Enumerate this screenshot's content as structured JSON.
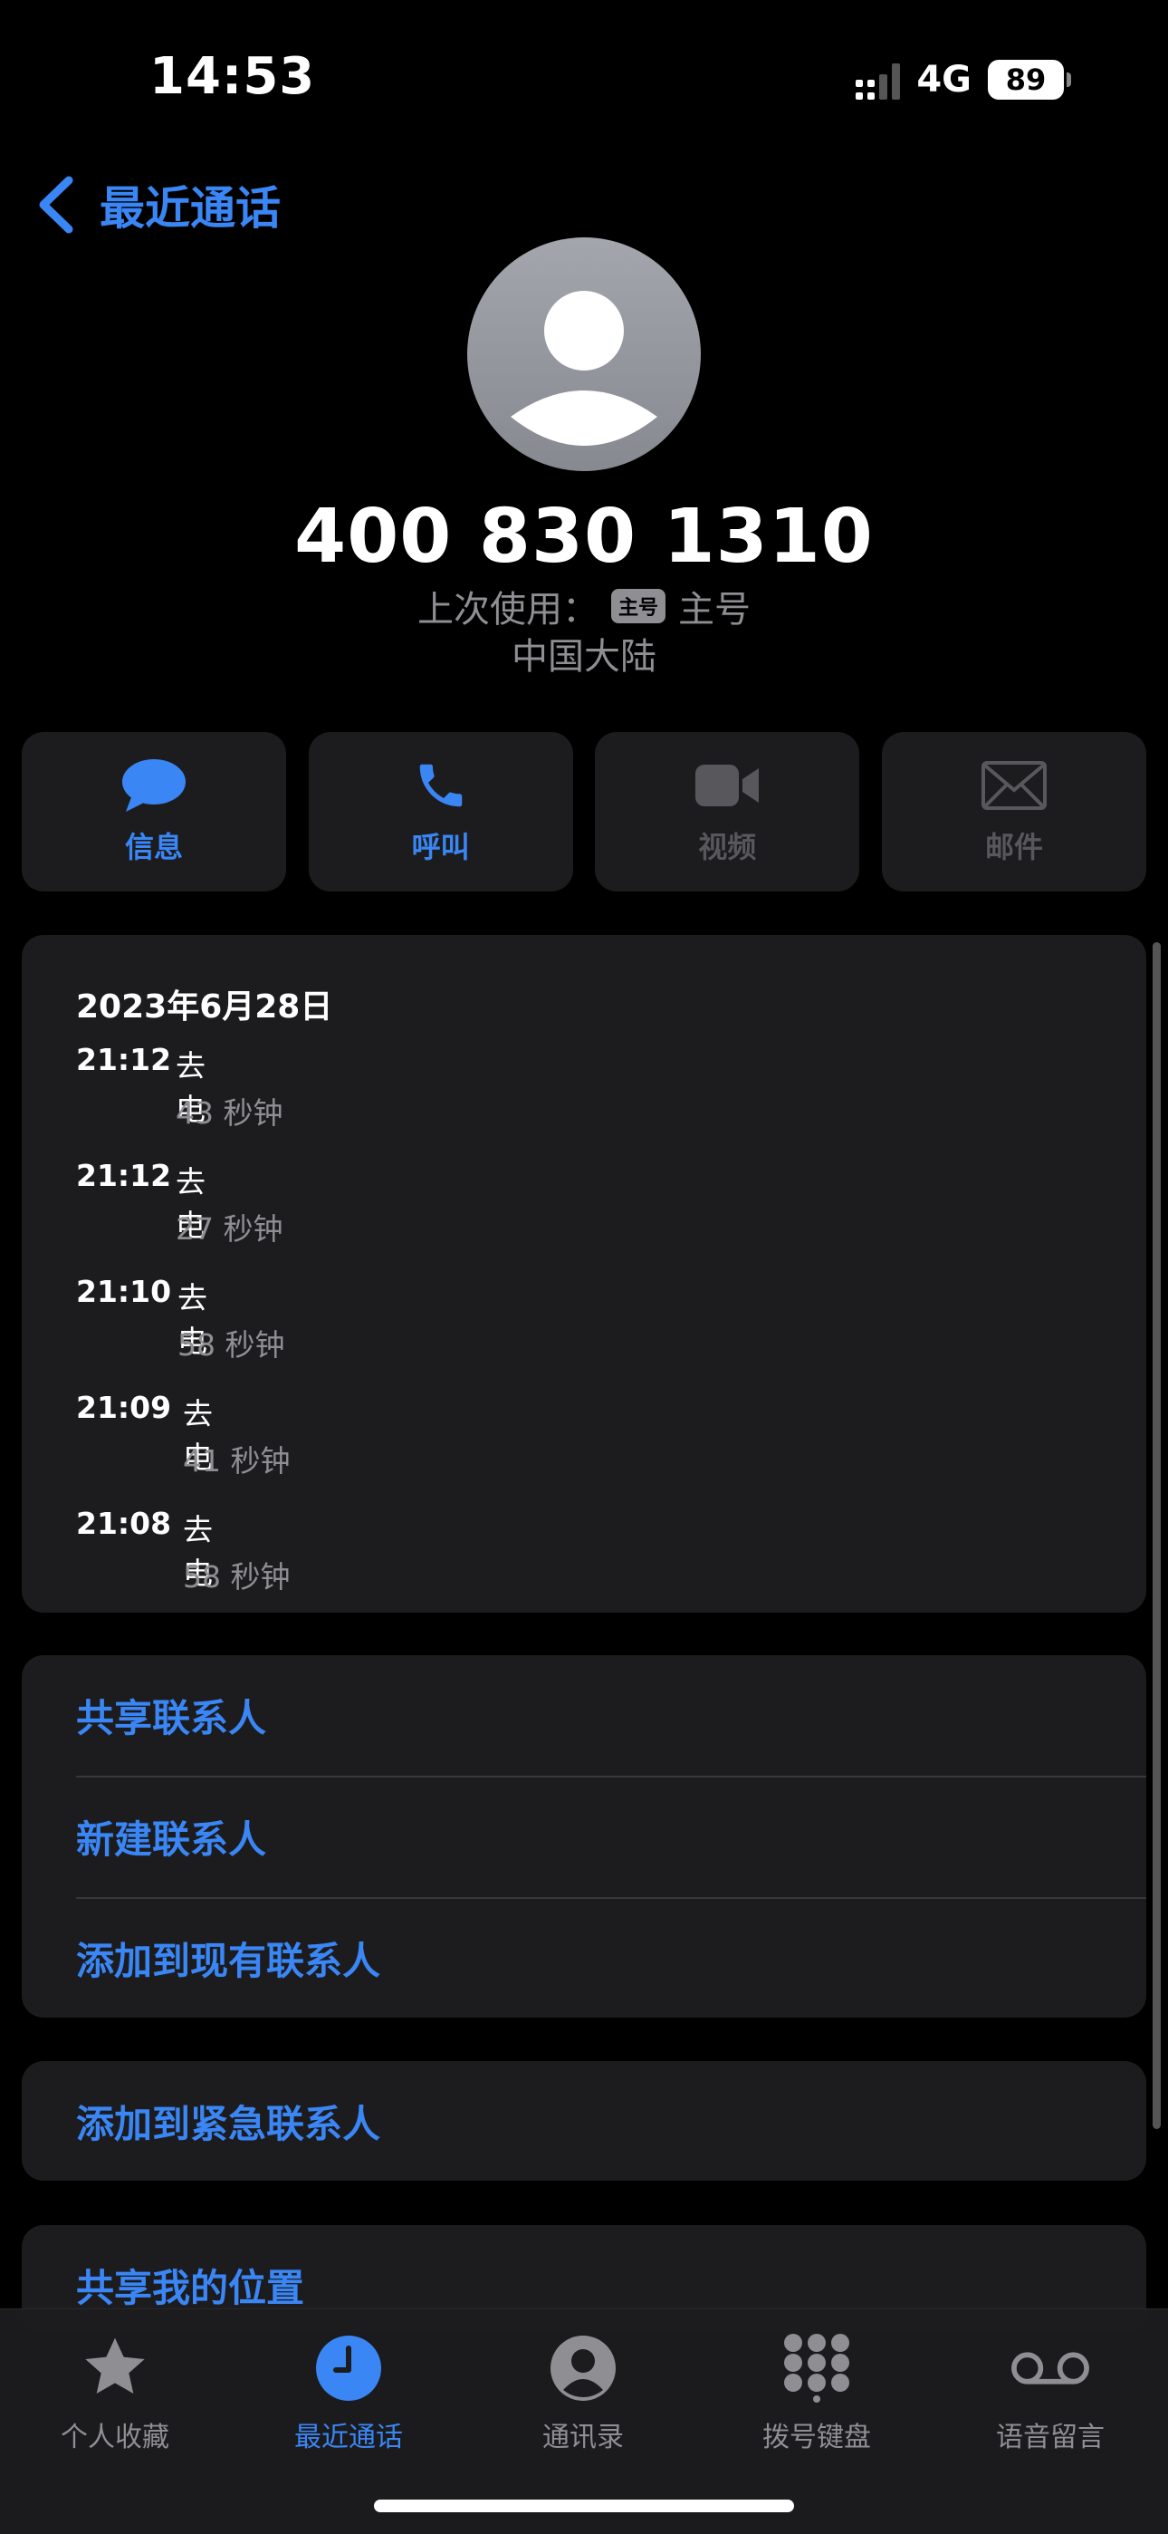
{
  "status_bar": {
    "time": "14:53",
    "network": "4G",
    "battery": "89"
  },
  "nav": {
    "back_label": "最近通话"
  },
  "contact": {
    "number": "400 830 1310",
    "last_used_label": "上次使用：",
    "line_tag": "主号",
    "line_name": "主号",
    "region": "中国大陆"
  },
  "actions": [
    {
      "label": "信息",
      "icon": "message-icon",
      "enabled": true
    },
    {
      "label": "呼叫",
      "icon": "phone-icon",
      "enabled": true
    },
    {
      "label": "视频",
      "icon": "video-icon",
      "enabled": false
    },
    {
      "label": "邮件",
      "icon": "mail-icon",
      "enabled": false
    }
  ],
  "history": {
    "date": "2023年6月28日",
    "calls": [
      {
        "time": "21:12",
        "type": "去电",
        "duration": "43 秒钟"
      },
      {
        "time": "21:12",
        "type": "去电",
        "duration": "27 秒钟"
      },
      {
        "time": "21:10",
        "type": "去电",
        "duration": "58 秒钟"
      },
      {
        "time": "21:09",
        "type": "去电",
        "duration": "41 秒钟"
      },
      {
        "time": "21:08",
        "type": "去电",
        "duration": "58 秒钟"
      }
    ]
  },
  "contact_actions": {
    "share": "共享联系人",
    "new": "新建联系人",
    "add_existing": "添加到现有联系人"
  },
  "emergency": "添加到紧急联系人",
  "share_location": "共享我的位置",
  "tabs": [
    {
      "label": "个人收藏",
      "icon": "star-icon",
      "active": false
    },
    {
      "label": "最近通话",
      "icon": "clock-icon",
      "active": true
    },
    {
      "label": "通讯录",
      "icon": "contacts-icon",
      "active": false
    },
    {
      "label": "拨号键盘",
      "icon": "keypad-icon",
      "active": false
    },
    {
      "label": "语音留言",
      "icon": "voicemail-icon",
      "active": false
    }
  ],
  "colors": {
    "accent": "#3a86f5",
    "card": "#1c1c1e",
    "secondary_text": "#8e8e93"
  }
}
